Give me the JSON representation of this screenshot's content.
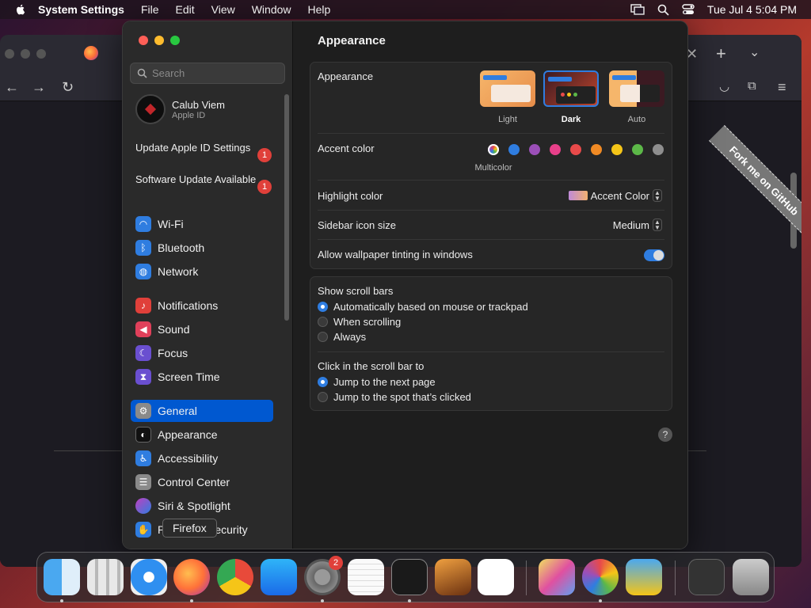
{
  "menubar": {
    "app_name": "System Settings",
    "menus": [
      "File",
      "Edit",
      "View",
      "Window",
      "Help"
    ],
    "datetime": "Tue Jul 4  5:04 PM"
  },
  "browser": {
    "ribbon_text": "Fork me on GitHub"
  },
  "settings": {
    "search_placeholder": "Search",
    "account": {
      "name": "Calub Viem",
      "sub": "Apple ID"
    },
    "notices": [
      {
        "label": "Update Apple ID Settings",
        "badge": "1"
      },
      {
        "label": "Software Update Available",
        "badge": "1"
      }
    ],
    "sidebar_items": [
      {
        "label": "Wi-Fi",
        "icon": "wifi-icon",
        "color": "#2f7de0"
      },
      {
        "label": "Bluetooth",
        "icon": "bluetooth-icon",
        "color": "#2f7de0"
      },
      {
        "label": "Network",
        "icon": "globe-icon",
        "color": "#2f7de0"
      },
      {
        "label": "Notifications",
        "icon": "bell-icon",
        "color": "#e0403a"
      },
      {
        "label": "Sound",
        "icon": "speaker-icon",
        "color": "#e0405a"
      },
      {
        "label": "Focus",
        "icon": "moon-icon",
        "color": "#6a4fd0"
      },
      {
        "label": "Screen Time",
        "icon": "hourglass-icon",
        "color": "#6a4fd0"
      },
      {
        "label": "General",
        "icon": "gear-icon",
        "color": "#8a8a8a"
      },
      {
        "label": "Appearance",
        "icon": "appearance-icon",
        "color": "#111111"
      },
      {
        "label": "Accessibility",
        "icon": "accessibility-icon",
        "color": "#2f7de0"
      },
      {
        "label": "Control Center",
        "icon": "toggles-icon",
        "color": "#8a8a8a"
      },
      {
        "label": "Siri & Spotlight",
        "icon": "siri-icon",
        "color": "#c040c0"
      },
      {
        "label": "Privacy & Security",
        "icon": "hand-icon",
        "color": "#2f7de0"
      }
    ],
    "active_item": "General",
    "title": "Appearance",
    "appearance": {
      "label": "Appearance",
      "options": [
        "Light",
        "Dark",
        "Auto"
      ],
      "selected": "Dark"
    },
    "accent": {
      "label": "Accent color",
      "selected_name": "Multicolor",
      "colors": [
        "multicolor",
        "#2f7de0",
        "#9b4fb8",
        "#e8408a",
        "#e84a4a",
        "#f08a24",
        "#f5c518",
        "#5cb848",
        "#8e8e8e"
      ]
    },
    "highlight": {
      "label": "Highlight color",
      "value": "Accent Color"
    },
    "icon_size": {
      "label": "Sidebar icon size",
      "value": "Medium"
    },
    "tinting": {
      "label": "Allow wallpaper tinting in windows",
      "on": true
    },
    "scroll_bars": {
      "label": "Show scroll bars",
      "options": [
        "Automatically based on mouse or trackpad",
        "When scrolling",
        "Always"
      ],
      "selected": 0
    },
    "click_scroll": {
      "label": "Click in the scroll bar to",
      "options": [
        "Jump to the next page",
        "Jump to the spot that’s clicked"
      ],
      "selected": 0
    },
    "help": "?"
  },
  "dock": {
    "tooltip": "Firefox",
    "settings_badge": "2"
  }
}
